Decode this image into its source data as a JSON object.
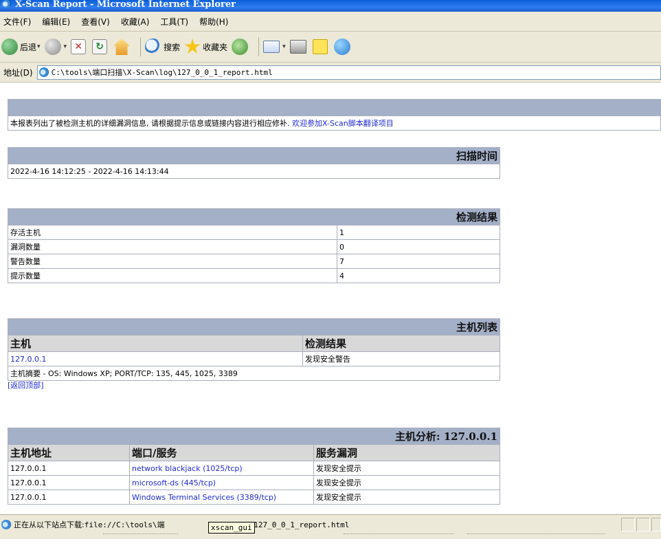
{
  "window": {
    "title": "X-Scan Report - Microsoft Internet Explorer"
  },
  "menu": [
    "文件(F)",
    "编辑(E)",
    "查看(V)",
    "收藏(A)",
    "工具(T)",
    "帮助(H)"
  ],
  "toolbar": {
    "back_label": "后退",
    "search_label": "搜索",
    "favorites_label": "收藏夹"
  },
  "address": {
    "label": "地址(D)",
    "url": "C:\\tools\\端口扫描\\X-Scan\\log\\127_0_0_1_report.html"
  },
  "report": {
    "intro_text": "本报表列出了被检测主机的详细漏洞信息, 请根据提示信息或链接内容进行相应修补.",
    "intro_link": "欢迎参加X-Scan脚本翻译项目",
    "scan_time": {
      "header": "扫描时间",
      "value": "2022-4-16 14:12:25 - 2022-4-16 14:13:44"
    },
    "results": {
      "header": "检测结果",
      "rows": [
        {
          "label": "存活主机",
          "value": "1"
        },
        {
          "label": "漏洞数量",
          "value": "0"
        },
        {
          "label": "警告数量",
          "value": "7"
        },
        {
          "label": "提示数量",
          "value": "4"
        }
      ]
    },
    "host_list": {
      "header": "主机列表",
      "col_host": "主机",
      "col_result": "检测结果",
      "host": "127.0.0.1",
      "result": "发现安全警告",
      "summary_label": "主机摘要",
      "summary_text": " - OS: Windows XP; PORT/TCP: 135, 445, 1025, 3389",
      "back_top": "[返回顶部]"
    },
    "host_analysis": {
      "header": "主机分析: 127.0.0.1",
      "col_addr": "主机地址",
      "col_port": "端口/服务",
      "col_vuln": "服务漏洞",
      "rows": [
        {
          "addr": "127.0.0.1",
          "port": "network blackjack (1025/tcp)",
          "vuln": "发现安全提示"
        },
        {
          "addr": "127.0.0.1",
          "port": "microsoft-ds (445/tcp)",
          "vuln": "发现安全提示"
        },
        {
          "addr": "127.0.0.1",
          "port": "Windows Terminal Services (3389/tcp)",
          "vuln": "发现安全提示"
        }
      ]
    }
  },
  "status": {
    "prefix": "正在从以下站点下载:",
    "path_part1": " file://C:\\tools\\端",
    "path_part2": "Scan\\log\\127_0_0_1_report.html",
    "tooltip": "xscan_gui"
  },
  "colors": {
    "section_header_bg": "#a4b0c8",
    "subheader_bg": "#d8d8d8",
    "link": "#1f2ad8"
  }
}
